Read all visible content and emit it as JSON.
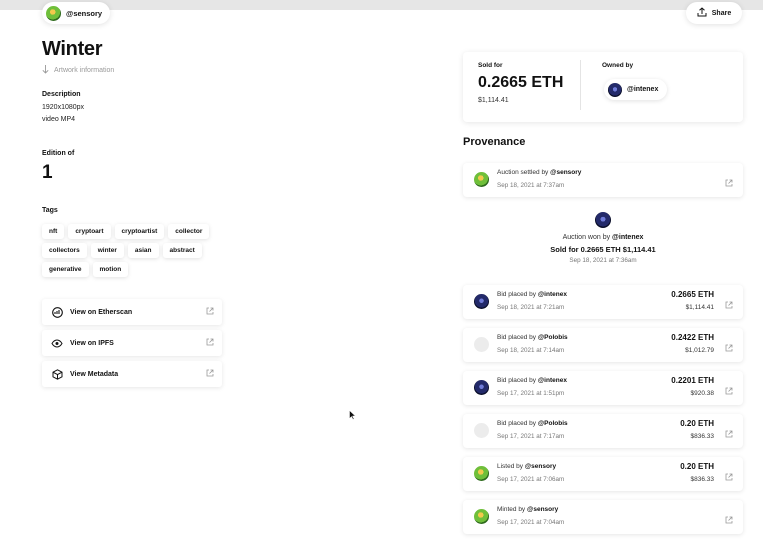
{
  "header": {
    "creator_handle": "@sensory",
    "share_label": "Share"
  },
  "artwork": {
    "title": "Winter",
    "info_link": "Artwork information",
    "description_label": "Description",
    "description_lines": [
      "1920x1080px",
      "video MP4"
    ],
    "edition_label": "Edition of",
    "edition_count": "1",
    "tags_label": "Tags",
    "tags": [
      "nft",
      "cryptoart",
      "cryptoartist",
      "collector",
      "collectors",
      "winter",
      "asian",
      "abstract",
      "generative",
      "motion"
    ]
  },
  "links": [
    {
      "label": "View on Etherscan",
      "icon": "etherscan-icon"
    },
    {
      "label": "View on IPFS",
      "icon": "eye-icon"
    },
    {
      "label": "View Metadata",
      "icon": "cube-icon"
    }
  ],
  "sale": {
    "sold_label": "Sold for",
    "price_eth": "0.2665 ETH",
    "price_usd": "$1,114.41",
    "owned_label": "Owned by",
    "owner_handle": "@intenex"
  },
  "provenance": {
    "title": "Provenance",
    "settled": {
      "action": "Auction settled by",
      "user": "@sensory",
      "date": "Sep 18, 2021 at 7:37am"
    },
    "won": {
      "action": "Auction won by",
      "user": "@intenex",
      "sold_text": "Sold for 0.2665 ETH $1,114.41",
      "date": "Sep 18, 2021 at 7:36am"
    },
    "events": [
      {
        "action": "Bid placed by",
        "user": "@intenex",
        "date": "Sep 18, 2021 at 7:21am",
        "eth": "0.2665 ETH",
        "usd": "$1,114.41",
        "avatar": "dark"
      },
      {
        "action": "Bid placed by",
        "user": "@Polobis",
        "date": "Sep 18, 2021 at 7:14am",
        "eth": "0.2422 ETH",
        "usd": "$1,012.79",
        "avatar": "empty"
      },
      {
        "action": "Bid placed by",
        "user": "@intenex",
        "date": "Sep 17, 2021 at 1:51pm",
        "eth": "0.2201 ETH",
        "usd": "$920.38",
        "avatar": "dark"
      },
      {
        "action": "Bid placed by",
        "user": "@Polobis",
        "date": "Sep 17, 2021 at 7:17am",
        "eth": "0.20 ETH",
        "usd": "$836.33",
        "avatar": "empty"
      },
      {
        "action": "Listed by",
        "user": "@sensory",
        "date": "Sep 17, 2021 at 7:06am",
        "eth": "0.20 ETH",
        "usd": "$836.33",
        "avatar": "green"
      },
      {
        "action": "Minted by",
        "user": "@sensory",
        "date": "Sep 17, 2021 at 7:04am",
        "eth": "",
        "usd": "",
        "avatar": "green"
      }
    ]
  }
}
